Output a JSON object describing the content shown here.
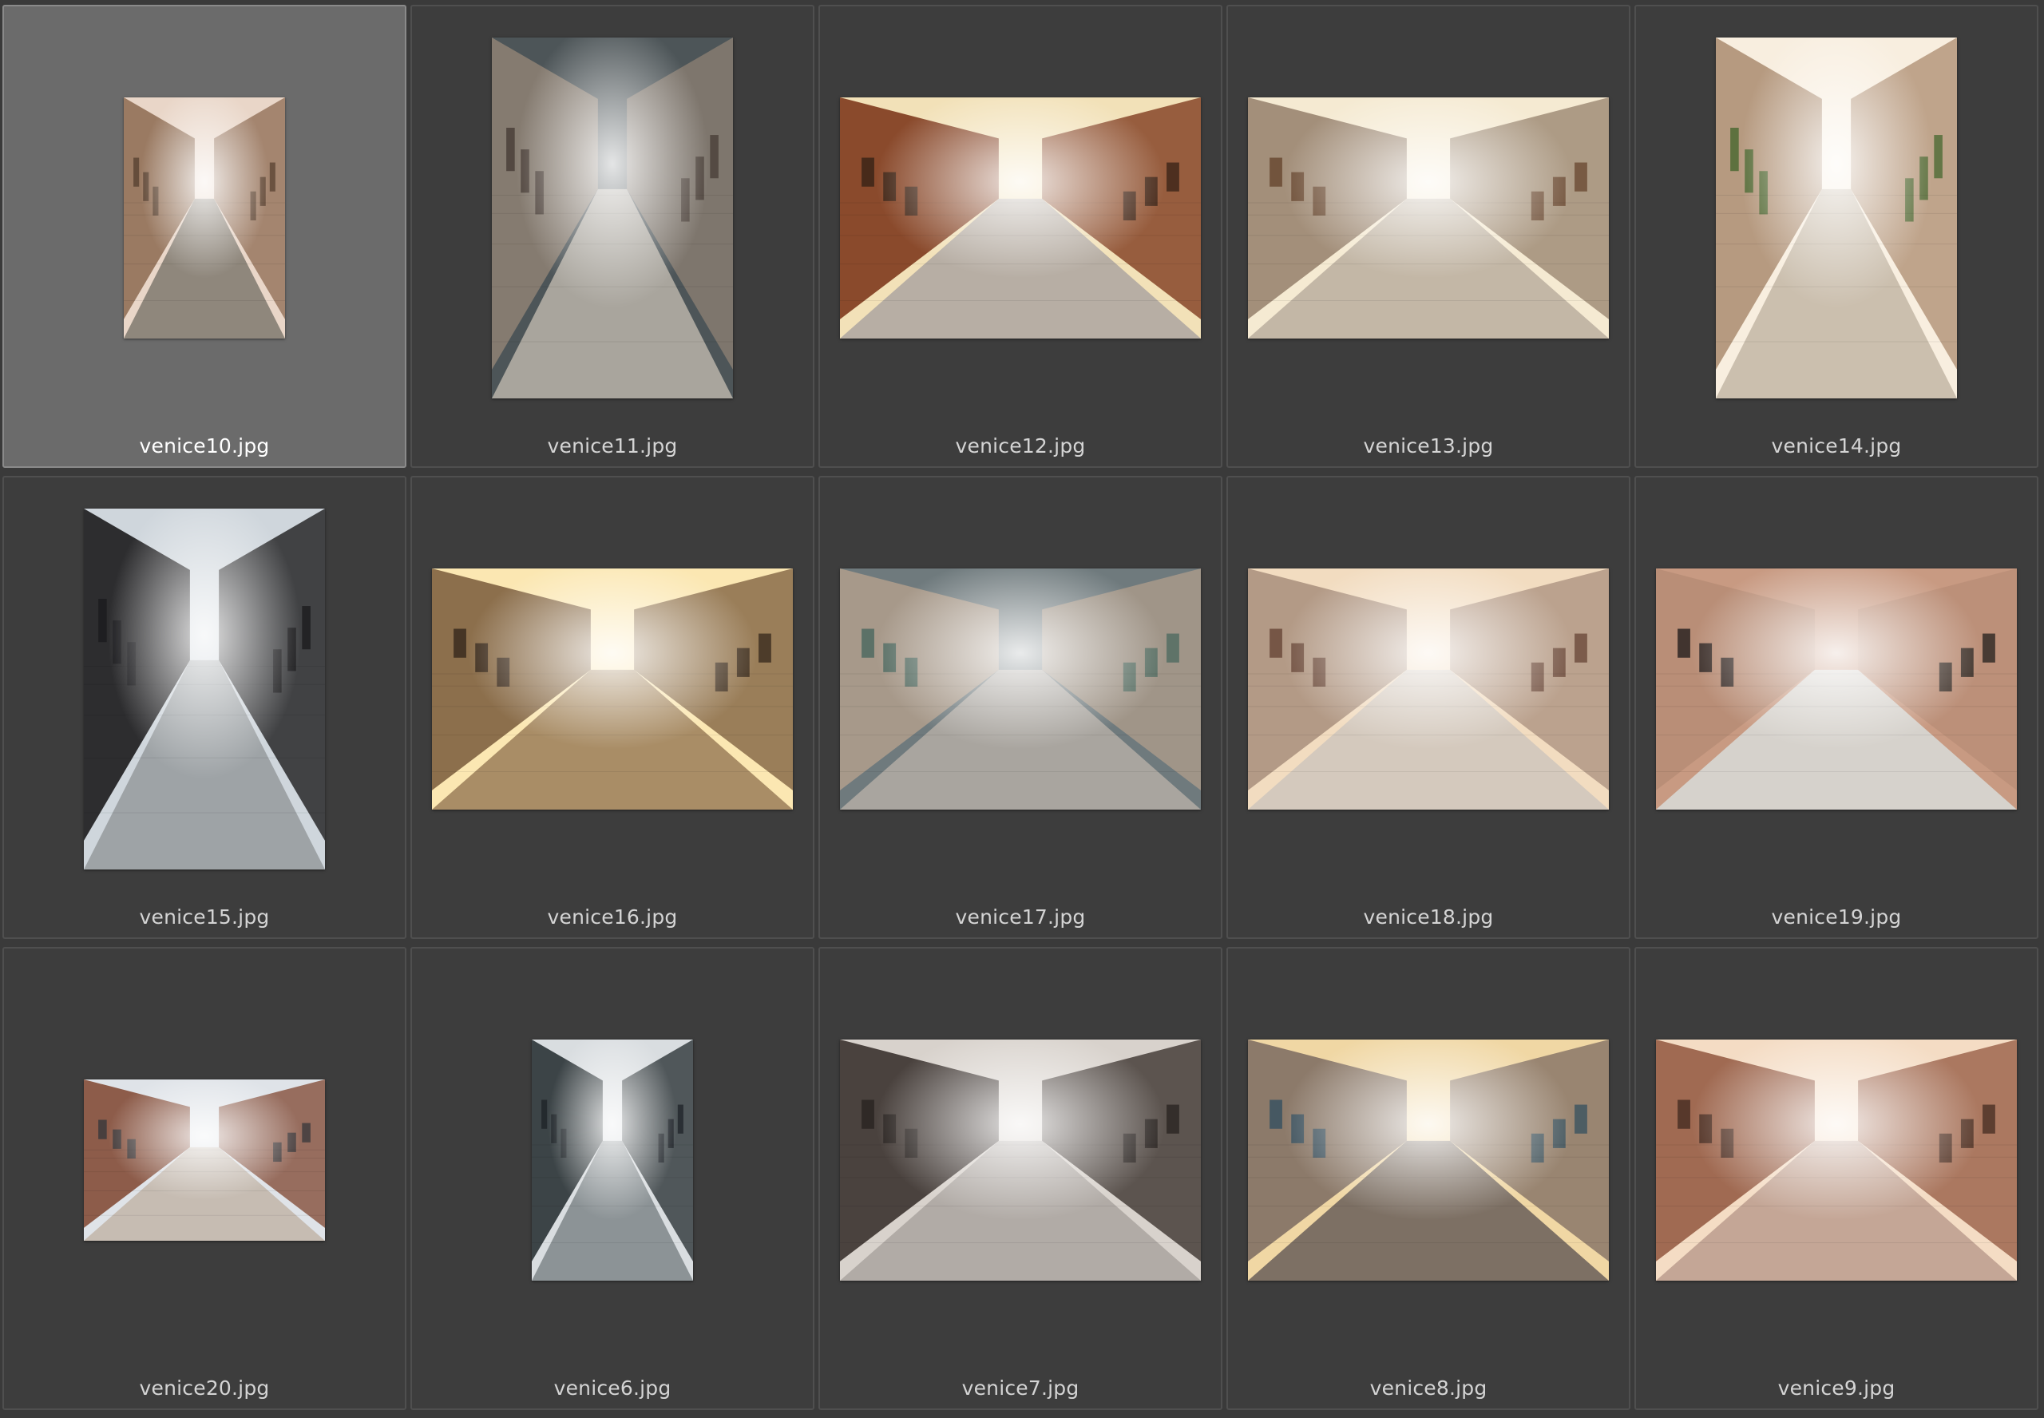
{
  "browser": {
    "selected_index": 0,
    "items": [
      {
        "filename": "venice10.jpg",
        "orientation": "portrait-small",
        "palette": {
          "sky": "#e9d6c8",
          "wall": "#9a7a62",
          "ground": "#8f877c",
          "accent": "#5c4535"
        }
      },
      {
        "filename": "venice11.jpg",
        "orientation": "portrait",
        "palette": {
          "sky": "#4d5558",
          "wall": "#857b70",
          "ground": "#a9a59d",
          "accent": "#4a4038"
        }
      },
      {
        "filename": "venice12.jpg",
        "orientation": "landscape",
        "palette": {
          "sky": "#f2e1b8",
          "wall": "#8a4a2c",
          "ground": "#b7aea4",
          "accent": "#3b2418"
        }
      },
      {
        "filename": "venice13.jpg",
        "orientation": "landscape",
        "palette": {
          "sky": "#f5ead2",
          "wall": "#a38f7a",
          "ground": "#c3b7a6",
          "accent": "#6a4a32"
        }
      },
      {
        "filename": "venice14.jpg",
        "orientation": "portrait",
        "palette": {
          "sky": "#f8eedf",
          "wall": "#b69a80",
          "ground": "#cbbfae",
          "accent": "#4e6a34"
        }
      },
      {
        "filename": "venice15.jpg",
        "orientation": "portrait",
        "palette": {
          "sky": "#cfd6dc",
          "wall": "#2d2d2f",
          "ground": "#9ea3a6",
          "accent": "#1c1c1e"
        }
      },
      {
        "filename": "venice16.jpg",
        "orientation": "landscape",
        "palette": {
          "sky": "#fbe7b2",
          "wall": "#8c6f4c",
          "ground": "#a98d66",
          "accent": "#3a2c1e"
        }
      },
      {
        "filename": "venice17.jpg",
        "orientation": "landscape",
        "palette": {
          "sky": "#6f7a7d",
          "wall": "#a7998a",
          "ground": "#a9a59f",
          "accent": "#4f6a60"
        }
      },
      {
        "filename": "venice18.jpg",
        "orientation": "landscape",
        "palette": {
          "sky": "#f2dcc0",
          "wall": "#b39a86",
          "ground": "#d4c9bd",
          "accent": "#6b4a3b"
        }
      },
      {
        "filename": "venice19.jpg",
        "orientation": "landscape",
        "palette": {
          "sky": "#c89a82",
          "wall": "#b98e77",
          "ground": "#d6d2cc",
          "accent": "#2b2522"
        }
      },
      {
        "filename": "venice20.jpg",
        "orientation": "landscape-small",
        "palette": {
          "sky": "#dfe3e8",
          "wall": "#8d5c4a",
          "ground": "#c6bcb2",
          "accent": "#3c3a3c"
        }
      },
      {
        "filename": "venice6.jpg",
        "orientation": "portrait-small",
        "palette": {
          "sky": "#d9dde0",
          "wall": "#3c4447",
          "ground": "#8c9396",
          "accent": "#20262a"
        }
      },
      {
        "filename": "venice7.jpg",
        "orientation": "landscape",
        "palette": {
          "sky": "#d8d2cc",
          "wall": "#4a423e",
          "ground": "#b1aba6",
          "accent": "#2a2422"
        }
      },
      {
        "filename": "venice8.jpg",
        "orientation": "landscape",
        "palette": {
          "sky": "#f0d7a4",
          "wall": "#8c7a6a",
          "ground": "#7d7064",
          "accent": "#3a5260"
        }
      },
      {
        "filename": "venice9.jpg",
        "orientation": "landscape",
        "palette": {
          "sky": "#f4dcc4",
          "wall": "#a06a52",
          "ground": "#c4a696",
          "accent": "#4a2f24"
        }
      }
    ]
  }
}
